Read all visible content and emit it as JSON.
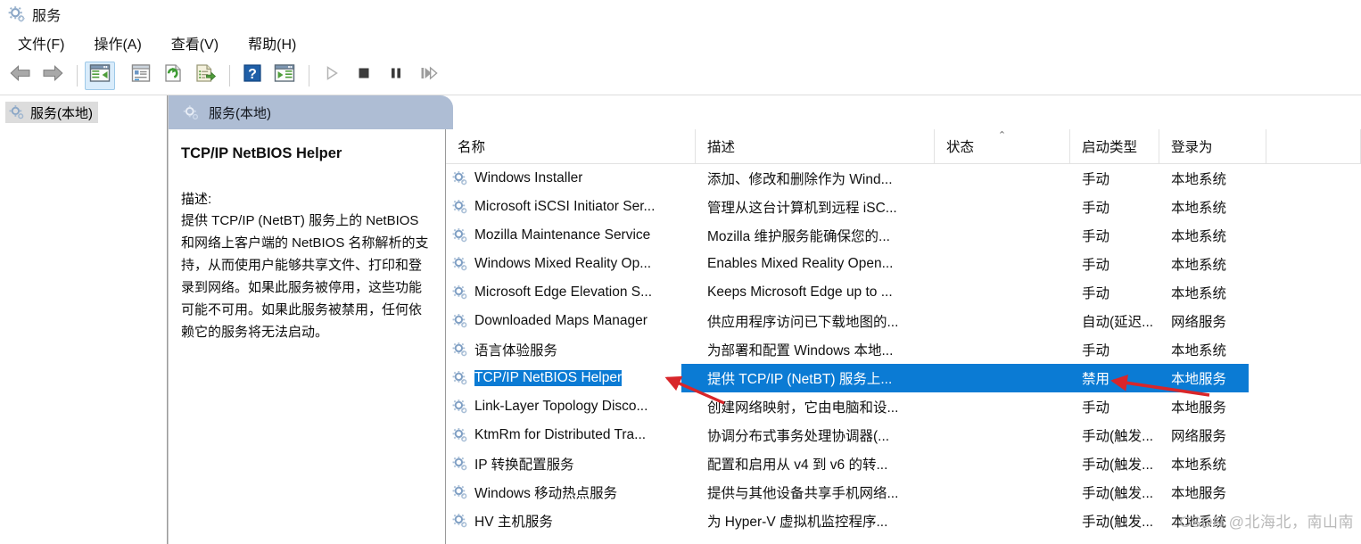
{
  "window": {
    "title": "服务",
    "icon": "services-gear-icon"
  },
  "menubar": {
    "items": [
      {
        "label": "文件(F)",
        "name": "menu-file"
      },
      {
        "label": "操作(A)",
        "name": "menu-action"
      },
      {
        "label": "查看(V)",
        "name": "menu-view"
      },
      {
        "label": "帮助(H)",
        "name": "menu-help"
      }
    ]
  },
  "toolbar": {
    "buttons": [
      {
        "icon": "back-arrow-icon",
        "label": "后退"
      },
      {
        "icon": "forward-arrow-icon",
        "label": "前进"
      },
      {
        "icon": "show-hide-tree-icon",
        "label": "显示/隐藏控制台树"
      },
      {
        "icon": "properties-icon",
        "label": "属性"
      },
      {
        "icon": "refresh-icon",
        "label": "刷新"
      },
      {
        "icon": "export-list-icon",
        "label": "导出列表"
      },
      {
        "icon": "help-icon",
        "label": "帮助"
      },
      {
        "icon": "show-action-pane-icon",
        "label": "显示/隐藏操作窗格"
      },
      {
        "icon": "play-icon",
        "label": "启动服务"
      },
      {
        "icon": "stop-icon",
        "label": "停止服务"
      },
      {
        "icon": "pause-icon",
        "label": "暂停服务"
      },
      {
        "icon": "restart-icon",
        "label": "重启动服务"
      }
    ]
  },
  "tree": {
    "items": [
      {
        "label": "服务(本地)",
        "icon": "services-gear-icon",
        "selected": true
      }
    ]
  },
  "pane": {
    "header_title": "服务(本地)",
    "header_icon": "services-gear-icon",
    "header_color": "#aebdd4"
  },
  "details": {
    "service_name": "TCP/IP NetBIOS Helper",
    "description_label": "描述:",
    "description_text": "提供 TCP/IP (NetBT) 服务上的 NetBIOS 和网络上客户端的 NetBIOS 名称解析的支持，从而使用户能够共享文件、打印和登录到网络。如果此服务被停用，这些功能可能不可用。如果此服务被禁用，任何依赖它的服务将无法启动。"
  },
  "list": {
    "columns": [
      {
        "label": "名称",
        "name": "column-name",
        "sorted": false
      },
      {
        "label": "描述",
        "name": "column-description",
        "sorted": false
      },
      {
        "label": "状态",
        "name": "column-status",
        "sorted": true,
        "sort_dir": "asc",
        "caret": "⌃"
      },
      {
        "label": "启动类型",
        "name": "column-startup-type",
        "sorted": false
      },
      {
        "label": "登录为",
        "name": "column-logon-as",
        "sorted": false
      }
    ],
    "rows": [
      {
        "name": "Windows Installer",
        "description": "添加、修改和删除作为 Wind...",
        "status": "",
        "startup": "手动",
        "logon": "本地系统",
        "selected": false
      },
      {
        "name": "Microsoft iSCSI Initiator Ser...",
        "description": "管理从这台计算机到远程 iSC...",
        "status": "",
        "startup": "手动",
        "logon": "本地系统",
        "selected": false
      },
      {
        "name": "Mozilla Maintenance Service",
        "description": "Mozilla 维护服务能确保您的...",
        "status": "",
        "startup": "手动",
        "logon": "本地系统",
        "selected": false
      },
      {
        "name": "Windows Mixed Reality Op...",
        "description": "Enables Mixed Reality Open...",
        "status": "",
        "startup": "手动",
        "logon": "本地系统",
        "selected": false
      },
      {
        "name": "Microsoft Edge Elevation S...",
        "description": "Keeps Microsoft Edge up to ...",
        "status": "",
        "startup": "手动",
        "logon": "本地系统",
        "selected": false
      },
      {
        "name": "Downloaded Maps Manager",
        "description": "供应用程序访问已下载地图的...",
        "status": "",
        "startup": "自动(延迟...",
        "logon": "网络服务",
        "selected": false
      },
      {
        "name": "语言体验服务",
        "description": "为部署和配置 Windows 本地...",
        "status": "",
        "startup": "手动",
        "logon": "本地系统",
        "selected": false
      },
      {
        "name": "TCP/IP NetBIOS Helper",
        "description": "提供 TCP/IP (NetBT) 服务上...",
        "status": "",
        "startup": "禁用",
        "logon": "本地服务",
        "selected": true
      },
      {
        "name": "Link-Layer Topology Disco...",
        "description": "创建网络映射，它由电脑和设...",
        "status": "",
        "startup": "手动",
        "logon": "本地服务",
        "selected": false
      },
      {
        "name": "KtmRm for Distributed Tra...",
        "description": "协调分布式事务处理协调器(...",
        "status": "",
        "startup": "手动(触发...",
        "logon": "网络服务",
        "selected": false
      },
      {
        "name": "IP 转换配置服务",
        "description": "配置和启用从 v4 到 v6 的转...",
        "status": "",
        "startup": "手动(触发...",
        "logon": "本地系统",
        "selected": false
      },
      {
        "name": "Windows 移动热点服务",
        "description": "提供与其他设备共享手机网络...",
        "status": "",
        "startup": "手动(触发...",
        "logon": "本地服务",
        "selected": false
      },
      {
        "name": "HV 主机服务",
        "description": "为 Hyper-V 虚拟机监控程序...",
        "status": "",
        "startup": "手动(触发...",
        "logon": "本地系统",
        "selected": false
      }
    ]
  },
  "annotations": {
    "arrow_color": "#d8262a",
    "arrows": [
      {
        "name": "arrow-to-service-name",
        "points_at": "TCP/IP NetBIOS Helper"
      },
      {
        "name": "arrow-to-startup-type",
        "points_at": "禁用"
      }
    ]
  },
  "watermark": {
    "text": "CSDN @北海北，南山南"
  },
  "colors": {
    "selection_blue": "#0b7bd4",
    "header_blue_gray": "#aebdd4",
    "tree_selected_gray": "#dcdcdc",
    "toolbar_active": "#d9ecfb"
  }
}
